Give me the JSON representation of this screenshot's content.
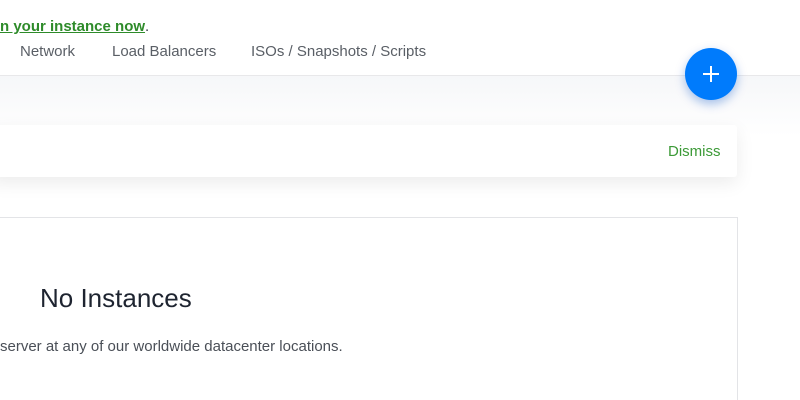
{
  "nav": {
    "tabs": [
      {
        "label": "Network"
      },
      {
        "label": "Load Balancers"
      },
      {
        "label": "ISOs / Snapshots / Scripts"
      }
    ]
  },
  "fab": {
    "icon": "plus-icon",
    "color": "#007bfc"
  },
  "banner": {
    "link_text": "n your instance now",
    "trailing": ".",
    "dismiss_label": "Dismiss",
    "accent_color": "#2e8b2a"
  },
  "empty_state": {
    "title": "No Instances",
    "description": "server at any of our worldwide datacenter locations."
  }
}
